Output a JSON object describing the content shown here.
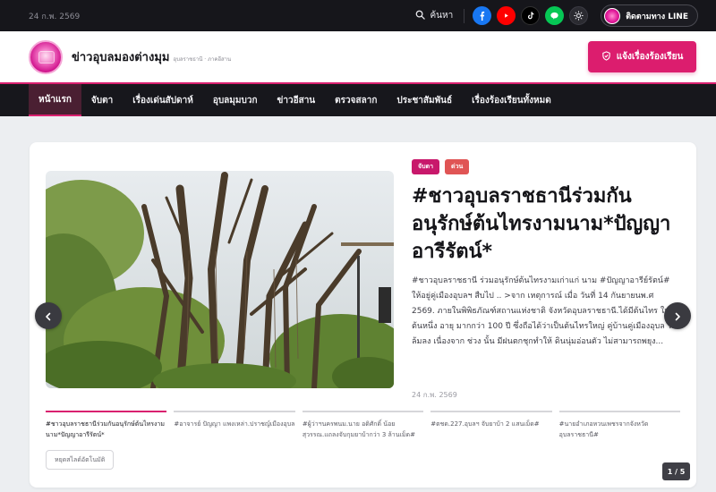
{
  "topbar": {
    "date": "24 ก.พ. 2569",
    "search_label": "ค้นหา",
    "line_follow_label": "ติดตามทาง LINE"
  },
  "header": {
    "site_name": "ข่าวอุบลมองต่างมุม",
    "site_sub": "อุบลราชธานี · ภาคอีสาน",
    "report_button": "แจ้งเรื่องร้องเรียน"
  },
  "nav": {
    "items": [
      "หน้าแรก",
      "จับตา",
      "เรื่องเด่นสัปดาห์",
      "อุบลมุมบวก",
      "ข่าวอีสาน",
      "ตรวจสลาก",
      "ประชาสัมพันธ์",
      "เรื่องร้องเรียนทั้งหมด"
    ],
    "active_index": 0
  },
  "feature": {
    "tags": [
      "จับตา",
      "ด่วน"
    ],
    "headline": "#ชาวอุบลราชธานีร่วมกันอนุรักษ์ต้นไทรงามนาม*ปัญญาอารีรัตน์*",
    "excerpt": "#ชาวอุบลราชธานี ร่วมอนุรักษ์ต้นไทรงามเก่าแก่ นาม #ปัญญาอารีย์รัตน์# ให้อยู่คู่เมืองอุบลฯ สืบไป .. >จาก เหตุการณ์ เมื่อ วันที่ 14 กันยายนพ.ศ 2569. ภายในพิพิธภัณฑ์สถานแห่งชาติ จังหวัดอุบลราชธานี.ได้มีต้นไทร ใหญ่ต้นหนึ่ง อายุ มากกว่า 100 ปี ซึ่งถือได้ว่าเป็นต้นไทรใหญ่ คู่บ้านคู่เมืองอุบล ได้ล้มลง เนื่องจาก ช่วง นั้น มีฝนตกชุกทำให้ ดินนุ่มอ่อนตัว ไม่สามารถพยุง...",
    "date": "24 ก.พ. 2569"
  },
  "thumbnails": [
    "#ชาวอุบลราชธานีร่วมกันอนุรักษ์ต้นไทรงามนาม*ปัญญาอารีรัตน์*",
    "#อาจารย์ ปัญญา แพงเหล่า.ปราชญ์เมืองอุบล",
    "#ผู้ว่าฯนครพนม.นาย อดิศักดิ์ น้อยสุวรรณ.แถลงจับกุมยาบ้ากว่า 3 ล้านเม็ด#",
    "#ตชด.227.อุบลฯ จับยาบ้า 2 แสนเม็ด#",
    "#นายอำเภอหวนเพชรจากจังหวัดอุบลราชธานี#"
  ],
  "pause_label": "หยุดสไลด์อัตโนมัติ",
  "counter": "1 / 5",
  "colors": {
    "accent": "#d9206f",
    "nav_bg": "#17171c",
    "topbar_bg": "#16161b"
  },
  "icons": [
    "search-icon",
    "facebook-icon",
    "youtube-icon",
    "tiktok-icon",
    "line-icon",
    "sun-icon",
    "shield-icon",
    "chevron-left-icon",
    "chevron-right-icon"
  ]
}
